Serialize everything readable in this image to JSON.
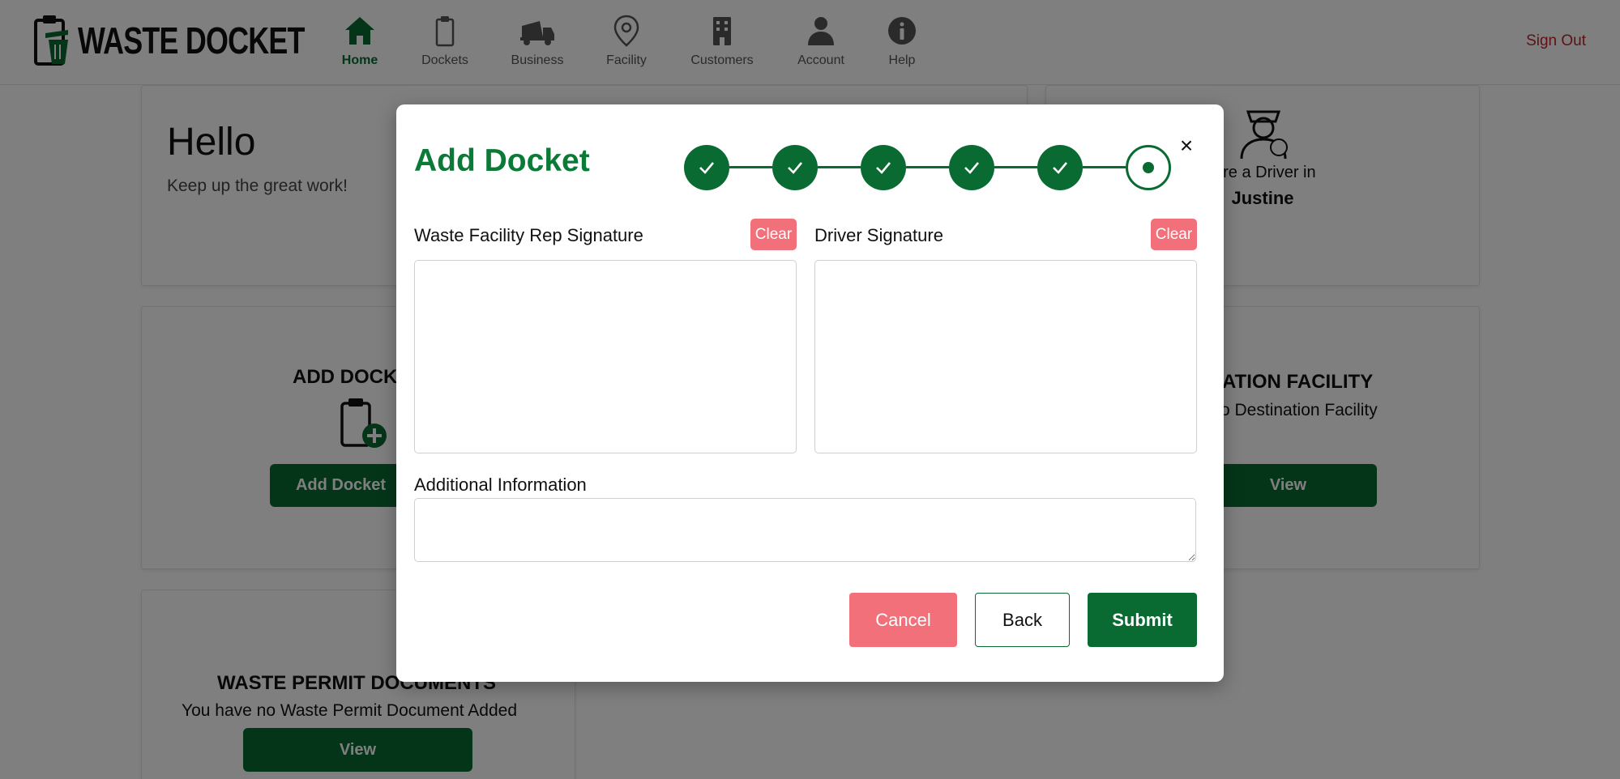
{
  "brand": {
    "name": "WASTE DOCKET"
  },
  "nav": {
    "items": [
      {
        "label": "Home",
        "icon": "home-icon",
        "active": true
      },
      {
        "label": "Dockets",
        "icon": "clipboard-icon"
      },
      {
        "label": "Business",
        "icon": "truck-icon"
      },
      {
        "label": "Facility",
        "icon": "location-pin-icon"
      },
      {
        "label": "Customers",
        "icon": "building-icon"
      },
      {
        "label": "Account",
        "icon": "user-icon"
      },
      {
        "label": "Help",
        "icon": "info-icon"
      }
    ],
    "sign_out": "Sign Out"
  },
  "dashboard": {
    "greeting": "Hello",
    "greeting_sub": "Keep up the great work!",
    "role_text": "are a Driver in",
    "role_company": "Justine",
    "add_docket_title": "ADD DOCK",
    "add_docket_button": "Add Docket",
    "destination_title": "ATION FACILITY",
    "destination_text": "o Destination Facility",
    "destination_button": "View",
    "permit_title": "WASTE PERMIT DOCUMENTS",
    "permit_text": "You have no Waste Permit Document Added",
    "permit_button": "View"
  },
  "modal": {
    "title": "Add Docket",
    "close": "×",
    "steps": {
      "total": 6,
      "completed": 5,
      "current": 6
    },
    "rep_signature_label": "Waste Facility Rep Signature",
    "driver_signature_label": "Driver Signature",
    "clear_label": "Clear",
    "additional_info_label": "Additional Information",
    "additional_info_value": "",
    "cancel_label": "Cancel",
    "back_label": "Back",
    "submit_label": "Submit"
  },
  "colors": {
    "brand_green": "#0a6b32",
    "title_green": "#0a7a37",
    "danger_pink": "#f2707a",
    "sign_out_red": "#c0232c"
  }
}
